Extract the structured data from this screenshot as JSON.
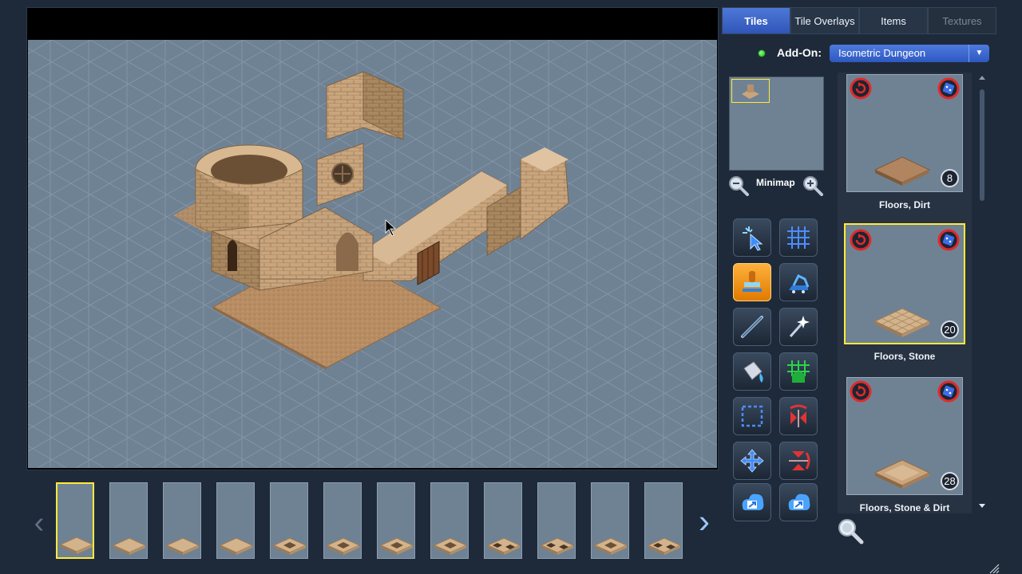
{
  "tabs": [
    {
      "label": "Tiles",
      "state": "active"
    },
    {
      "label": "Tile Overlays",
      "state": "normal"
    },
    {
      "label": "Items",
      "state": "normal"
    },
    {
      "label": "Textures",
      "state": "disabled"
    }
  ],
  "addon": {
    "label": "Add-On:",
    "value": "Isometric Dungeon"
  },
  "minimap": {
    "label": "Minimap"
  },
  "tools": [
    {
      "name": "select-tool-icon",
      "active": false
    },
    {
      "name": "grid-toggle-icon",
      "active": false
    },
    {
      "name": "stamp-tool-icon",
      "active": true
    },
    {
      "name": "excavator-tool-icon",
      "active": false
    },
    {
      "name": "line-tool-icon",
      "active": false
    },
    {
      "name": "magic-wand-icon",
      "active": false
    },
    {
      "name": "paint-bucket-icon",
      "active": false
    },
    {
      "name": "dungeon-generator-icon",
      "active": false
    },
    {
      "name": "rectangle-select-icon",
      "active": false
    },
    {
      "name": "flip-horizontal-icon",
      "active": false
    },
    {
      "name": "move-tool-icon",
      "active": false
    },
    {
      "name": "flip-vertical-icon",
      "active": false
    },
    {
      "name": "import-icon",
      "active": false
    },
    {
      "name": "export-icon",
      "active": false
    }
  ],
  "tiles": [
    {
      "label": "Floors, Dirt",
      "count": "8",
      "selected": false,
      "color": "#b08560"
    },
    {
      "label": "Floors, Stone",
      "count": "20",
      "selected": true,
      "color": "#d2b38c"
    },
    {
      "label": "Floors, Stone & Dirt",
      "count": "28",
      "selected": false,
      "color": "#c9a47c"
    }
  ],
  "filmstrip": {
    "selected_index": 0,
    "thumbs": [
      "floor-stone",
      "floor-stone",
      "floor-stone",
      "floor-stone",
      "floor-hole",
      "floor-hole",
      "floor-hole",
      "floor-hole",
      "floor-broken",
      "floor-broken",
      "floor-hole",
      "floor-broken"
    ]
  },
  "colors": {
    "accent": "#3b66cc",
    "canvas": "#6f8294",
    "selection": "#ffea3a",
    "stone": "#c9a57d",
    "dirt": "#a87e58"
  }
}
